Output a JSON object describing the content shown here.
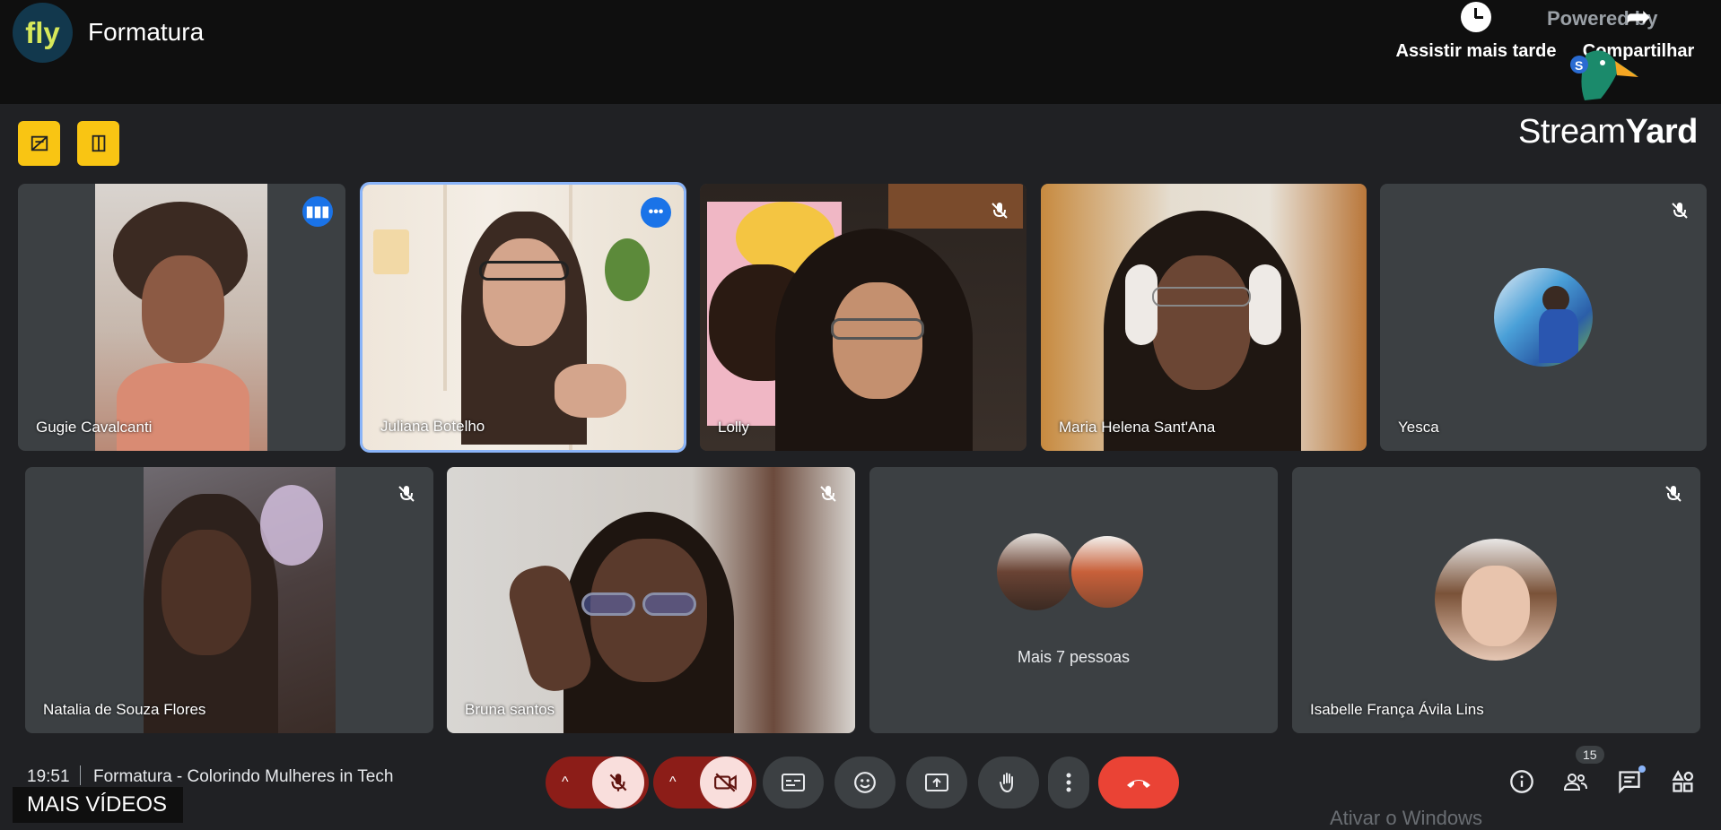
{
  "header": {
    "channel_logo_text": "fly",
    "video_title": "Formatura",
    "watch_later_label": "Assistir mais tarde",
    "share_label": "Compartilhar",
    "powered_by": "Powered by",
    "brand_plain": "Stream",
    "brand_bold": "Yard"
  },
  "participants": [
    {
      "name": "Gugie Cavalcanti",
      "status": "speaking"
    },
    {
      "name": "Juliana Botelho",
      "status": "more-options"
    },
    {
      "name": "Lolly",
      "status": "muted"
    },
    {
      "name": "Maria Helena Sant'Ana",
      "status": "unmuted"
    },
    {
      "name": "Yesca",
      "status": "muted"
    },
    {
      "name": "Natalia de Souza Flores",
      "status": "muted"
    },
    {
      "name": "Bruna santos",
      "status": "muted"
    },
    {
      "name": "Mais 7 pessoas",
      "status": "group"
    },
    {
      "name": "Isabelle França Ávila Lins",
      "status": "muted"
    }
  ],
  "bottom_bar": {
    "time": "19:51",
    "meeting_title": "Formatura - Colorindo Mulheres in Tech",
    "participants_count": "15"
  },
  "overlay": {
    "more_videos": "MAIS VÍDEOS",
    "windows_watermark": "Ativar o Windows"
  },
  "icons": {
    "mic_off": "mic-off-icon",
    "camera_off": "camera-off-icon",
    "captions": "captions-icon",
    "emoji": "emoji-icon",
    "present": "present-screen-icon",
    "raise_hand": "raise-hand-icon",
    "more": "more-vertical-icon",
    "hang_up": "hang-up-icon",
    "info": "info-icon",
    "people": "people-icon",
    "chat": "chat-icon",
    "activities": "activities-icon"
  },
  "colors": {
    "accent_yellow": "#f9c513",
    "tile_bg": "#3c4043",
    "active_border": "#8ab4f8",
    "hangup_red": "#ea4335"
  }
}
